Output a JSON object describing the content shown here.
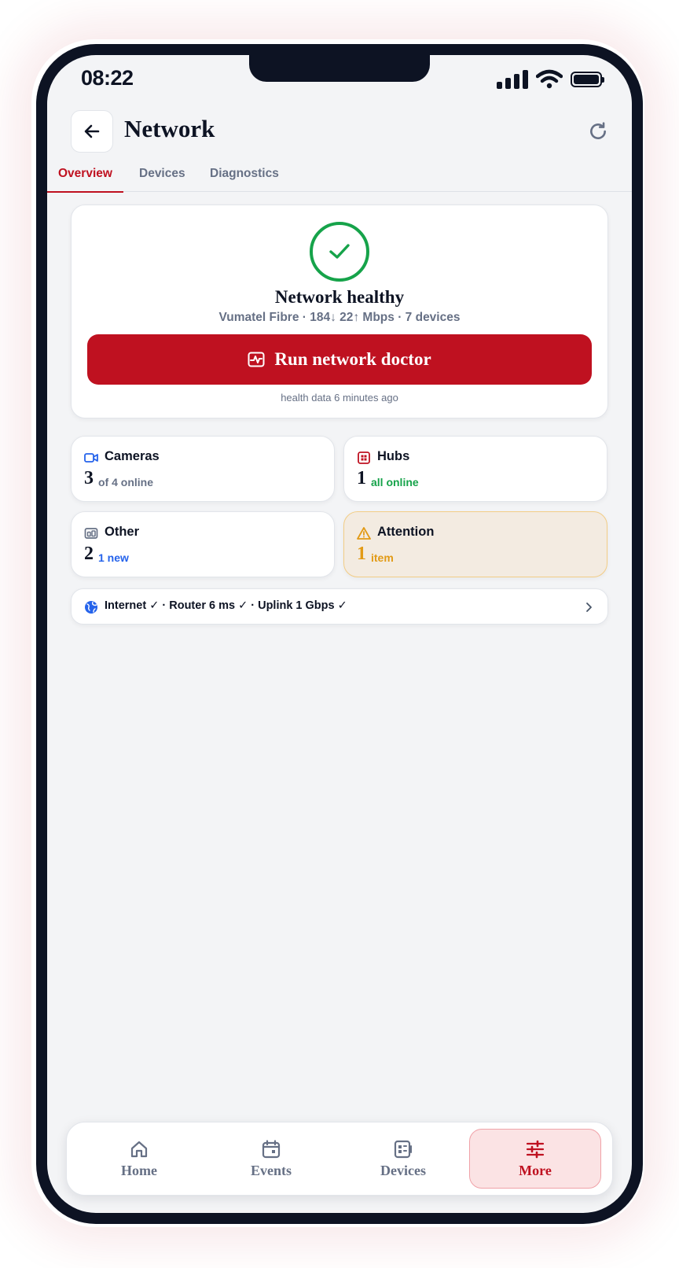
{
  "status_bar": {
    "time": "08:22"
  },
  "header": {
    "title": "Network"
  },
  "tabs": [
    {
      "label": "Overview",
      "active": true
    },
    {
      "label": "Devices",
      "active": false
    },
    {
      "label": "Diagnostics",
      "active": false
    }
  ],
  "hero": {
    "title": "Network healthy",
    "subtitle": "Vumatel Fibre · 184↓ 22↑ Mbps · 7 devices",
    "button_label": "Run network doctor",
    "footnote": "health data 6 minutes ago"
  },
  "stats": {
    "cameras": {
      "label": "Cameras",
      "value": "3",
      "sub": "of 4 online",
      "icon": "camera-icon"
    },
    "hubs": {
      "label": "Hubs",
      "value": "1",
      "sub": "all online",
      "icon": "hub-icon"
    },
    "other": {
      "label": "Other",
      "value": "2",
      "sub": "1 new",
      "icon": "devices-icon"
    },
    "attention": {
      "label": "Attention",
      "value": "1",
      "sub": "item",
      "icon": "warning-icon"
    }
  },
  "summary": {
    "text": "Internet ✓ · Router 6 ms ✓ · Uplink 1 Gbps ✓"
  },
  "nav": [
    {
      "label": "Home",
      "icon": "home-icon",
      "active": false
    },
    {
      "label": "Events",
      "icon": "calendar-icon",
      "active": false
    },
    {
      "label": "Devices",
      "icon": "devices-icon",
      "active": false
    },
    {
      "label": "More",
      "icon": "sliders-icon",
      "active": true
    }
  ],
  "colors": {
    "accent": "#bf1120",
    "healthy": "#16a34a",
    "warning": "#e29a15",
    "info": "#2563eb",
    "text": "#0d1323",
    "muted": "#667085"
  }
}
